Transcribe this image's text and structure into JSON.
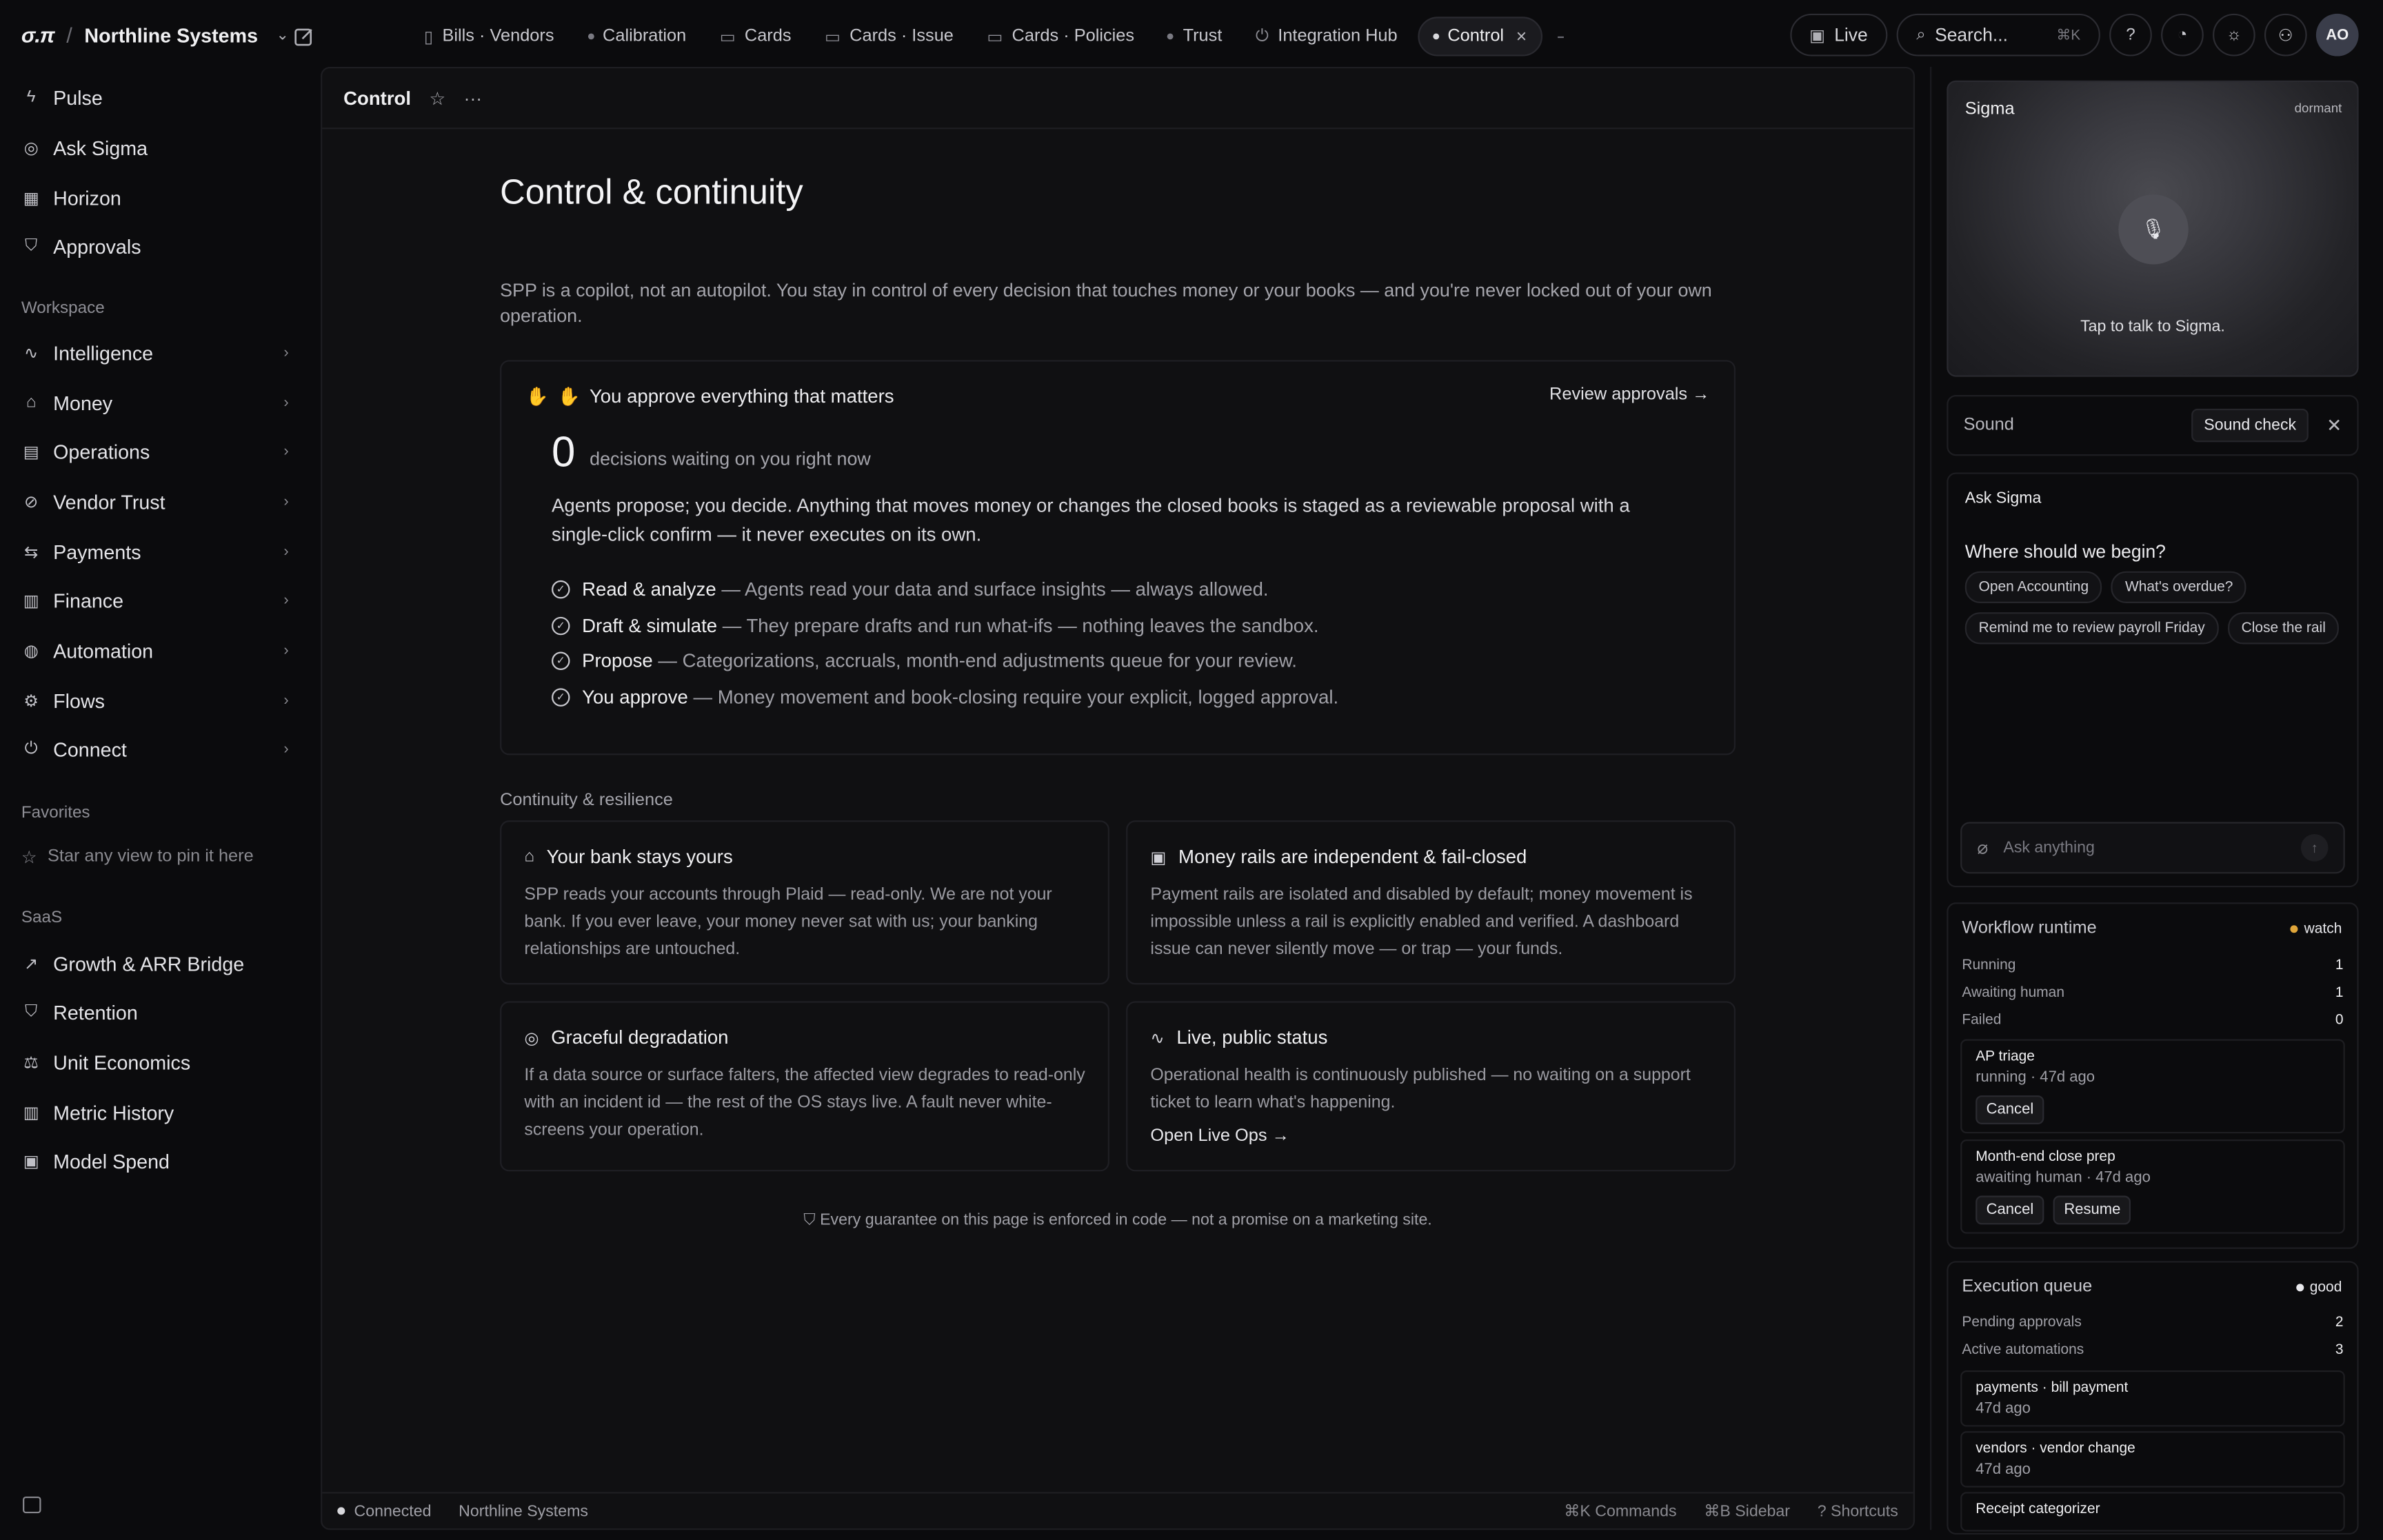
{
  "topbar": {
    "logo": "σ.π",
    "separator": "/",
    "org_name": "Northline Systems",
    "tabs": [
      {
        "label": "Bills · Vendors",
        "icon": "document-icon"
      },
      {
        "label": "Calibration",
        "icon": "dot"
      },
      {
        "label": "Cards",
        "icon": "card-icon"
      },
      {
        "label": "Cards · Issue",
        "icon": "card-icon"
      },
      {
        "label": "Cards · Policies",
        "icon": "card-icon"
      },
      {
        "label": "Trust",
        "icon": "dot"
      },
      {
        "label": "Integration Hub",
        "icon": "plug-icon"
      },
      {
        "label": "Control",
        "icon": "dot",
        "active": true
      }
    ],
    "live_label": "Live",
    "search_placeholder": "Search...",
    "search_shortcut": "⌘K",
    "avatar_initials": "AO"
  },
  "sidebar": {
    "top_items": [
      {
        "label": "Pulse",
        "icon": "bolt-icon"
      },
      {
        "label": "Ask Sigma",
        "icon": "globe-icon"
      },
      {
        "label": "Horizon",
        "icon": "calendar-icon"
      },
      {
        "label": "Approvals",
        "icon": "shield-icon"
      }
    ],
    "workspace_label": "Workspace",
    "workspace_items": [
      {
        "label": "Intelligence",
        "icon": "activity-icon"
      },
      {
        "label": "Money",
        "icon": "bank-icon"
      },
      {
        "label": "Operations",
        "icon": "clipboard-icon"
      },
      {
        "label": "Vendor Trust",
        "icon": "check-circle-icon"
      },
      {
        "label": "Payments",
        "icon": "arrows-icon"
      },
      {
        "label": "Finance",
        "icon": "receipt-icon"
      },
      {
        "label": "Automation",
        "icon": "gauge-icon"
      },
      {
        "label": "Flows",
        "icon": "flow-icon"
      },
      {
        "label": "Connect",
        "icon": "plug-icon"
      }
    ],
    "favorites_label": "Favorites",
    "favorites_empty": "Star any view to pin it here",
    "saas_label": "SaaS",
    "saas_items": [
      {
        "label": "Growth & ARR Bridge",
        "icon": "trend-up-icon"
      },
      {
        "label": "Retention",
        "icon": "shield-icon"
      },
      {
        "label": "Unit Economics",
        "icon": "scale-icon"
      },
      {
        "label": "Metric History",
        "icon": "bar-chart-icon"
      },
      {
        "label": "Model Spend",
        "icon": "chip-icon"
      }
    ]
  },
  "main": {
    "header_title": "Control",
    "page_title": "Control & continuity",
    "intro": "SPP is a copilot, not an autopilot. You stay in control of every decision that touches money or your books — and you're never locked out of your own operation.",
    "approve_card": {
      "title": "You approve everything that matters",
      "review_link": "Review approvals",
      "count": "0",
      "count_label": "decisions waiting on you right now",
      "paragraph": "Agents propose; you decide. Anything that moves money or changes the closed books is staged as a reviewable proposal with a single-click confirm — it never executes on its own.",
      "checks": [
        {
          "strong": "Read & analyze",
          "rest": " — Agents read your data and surface insights — always allowed."
        },
        {
          "strong": "Draft & simulate",
          "rest": " — They prepare drafts and run what-ifs — nothing leaves the sandbox."
        },
        {
          "strong": "Propose",
          "rest": " — Categorizations, accruals, month-end adjustments queue for your review."
        },
        {
          "strong": "You approve",
          "rest": " — Money movement and book-closing require your explicit, logged approval."
        }
      ]
    },
    "continuity_label": "Continuity & resilience",
    "tiles": [
      {
        "title": "Your bank stays yours",
        "body": "SPP reads your accounts through Plaid — read-only. We are not your bank. If you ever leave, your money never sat with us; your banking relationships are untouched.",
        "icon": "bank-icon"
      },
      {
        "title": "Money rails are independent & fail-closed",
        "body": "Payment rails are isolated and disabled by default; money movement is impossible unless a rail is explicitly enabled and verified. A dashboard issue can never silently move — or trap — your funds.",
        "icon": "rail-icon"
      },
      {
        "title": "Graceful degradation",
        "body": "If a data source or surface falters, the affected view degrades to read-only with an incident id — the rest of the OS stays live. A fault never white-screens your operation.",
        "icon": "lifebuoy-icon"
      },
      {
        "title": "Live, public status",
        "body": "Operational health is continuously published — no waiting on a support ticket to learn what's happening.",
        "link": "Open Live Ops",
        "icon": "pulse-icon"
      }
    ],
    "footer_note": "Every guarantee on this page is enforced in code — not a promise on a marketing site."
  },
  "statusbar": {
    "connection": "Connected",
    "org": "Northline Systems",
    "shortcuts": [
      "⌘K Commands",
      "⌘B Sidebar",
      "? Shortcuts"
    ]
  },
  "right_panel": {
    "voice": {
      "name": "Sigma",
      "state": "dormant",
      "hint": "Tap to talk to Sigma."
    },
    "sound": {
      "label": "Sound",
      "button": "Sound check"
    },
    "ask": {
      "title": "Ask Sigma",
      "question": "Where should we begin?",
      "chips": [
        "Open Accounting",
        "What's overdue?",
        "Remind me to review payroll Friday",
        "Close the rail"
      ],
      "placeholder": "Ask anything"
    },
    "workflow": {
      "title": "Workflow runtime",
      "badge": "watch",
      "badge_color": "#e0a63a",
      "rows": [
        {
          "k": "Running",
          "v": "1"
        },
        {
          "k": "Awaiting human",
          "v": "1"
        },
        {
          "k": "Failed",
          "v": "0"
        }
      ],
      "items": [
        {
          "name": "AP triage",
          "status": "running · 47d ago",
          "buttons": [
            "Cancel"
          ]
        },
        {
          "name": "Month-end close prep",
          "status": "awaiting human · 47d ago",
          "buttons": [
            "Cancel",
            "Resume"
          ]
        }
      ]
    },
    "queue": {
      "title": "Execution queue",
      "badge": "good",
      "badge_color": "#e8e8ec",
      "rows": [
        {
          "k": "Pending approvals",
          "v": "2"
        },
        {
          "k": "Active automations",
          "v": "3"
        }
      ],
      "items": [
        {
          "name": "payments · bill payment",
          "status": "47d ago"
        },
        {
          "name": "vendors · vendor change",
          "status": "47d ago"
        },
        {
          "name": "Receipt categorizer",
          "status": ""
        }
      ]
    }
  }
}
